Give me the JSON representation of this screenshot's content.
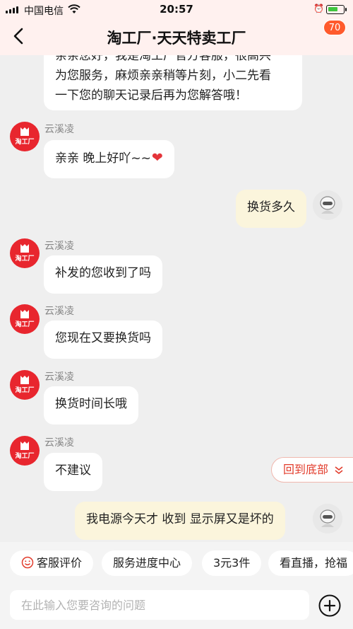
{
  "status_bar": {
    "carrier": "中国电信",
    "time": "20:57"
  },
  "header": {
    "title": "淘工厂·天天特卖工厂",
    "badge": "70"
  },
  "shop": {
    "avatar_text": "淘工厂",
    "sender_name": "云溪凌"
  },
  "messages": [
    {
      "from": "shop",
      "lines": [
        "亲亲您好，我是淘工厂官方客服，很高兴",
        "为您服务，麻烦亲亲稍等片刻，小二先看",
        "一下您的聊天记录后再为您解答哦！"
      ]
    },
    {
      "from": "shop",
      "text": "亲亲 晚上好吖~~",
      "emoji": "❤"
    },
    {
      "from": "me",
      "text": "换货多久"
    },
    {
      "from": "shop",
      "text": "补发的您收到了吗"
    },
    {
      "from": "shop",
      "text": "您现在又要换货吗"
    },
    {
      "from": "shop",
      "text": "换货时间长哦"
    },
    {
      "from": "shop",
      "text": "不建议"
    },
    {
      "from": "me",
      "text": "我电源今天才 收到  显示屏又是坏的"
    }
  ],
  "back_to_bottom": "回到底部",
  "quick_actions": [
    "客服评价",
    "服务进度中心",
    "3元3件",
    "看直播，抢福"
  ],
  "input": {
    "placeholder": "在此输入您要咨询的问题"
  },
  "colors": {
    "brand_red": "#e8262e",
    "header_bg": "#fff1ef",
    "my_bubble": "#fbf5dc"
  }
}
